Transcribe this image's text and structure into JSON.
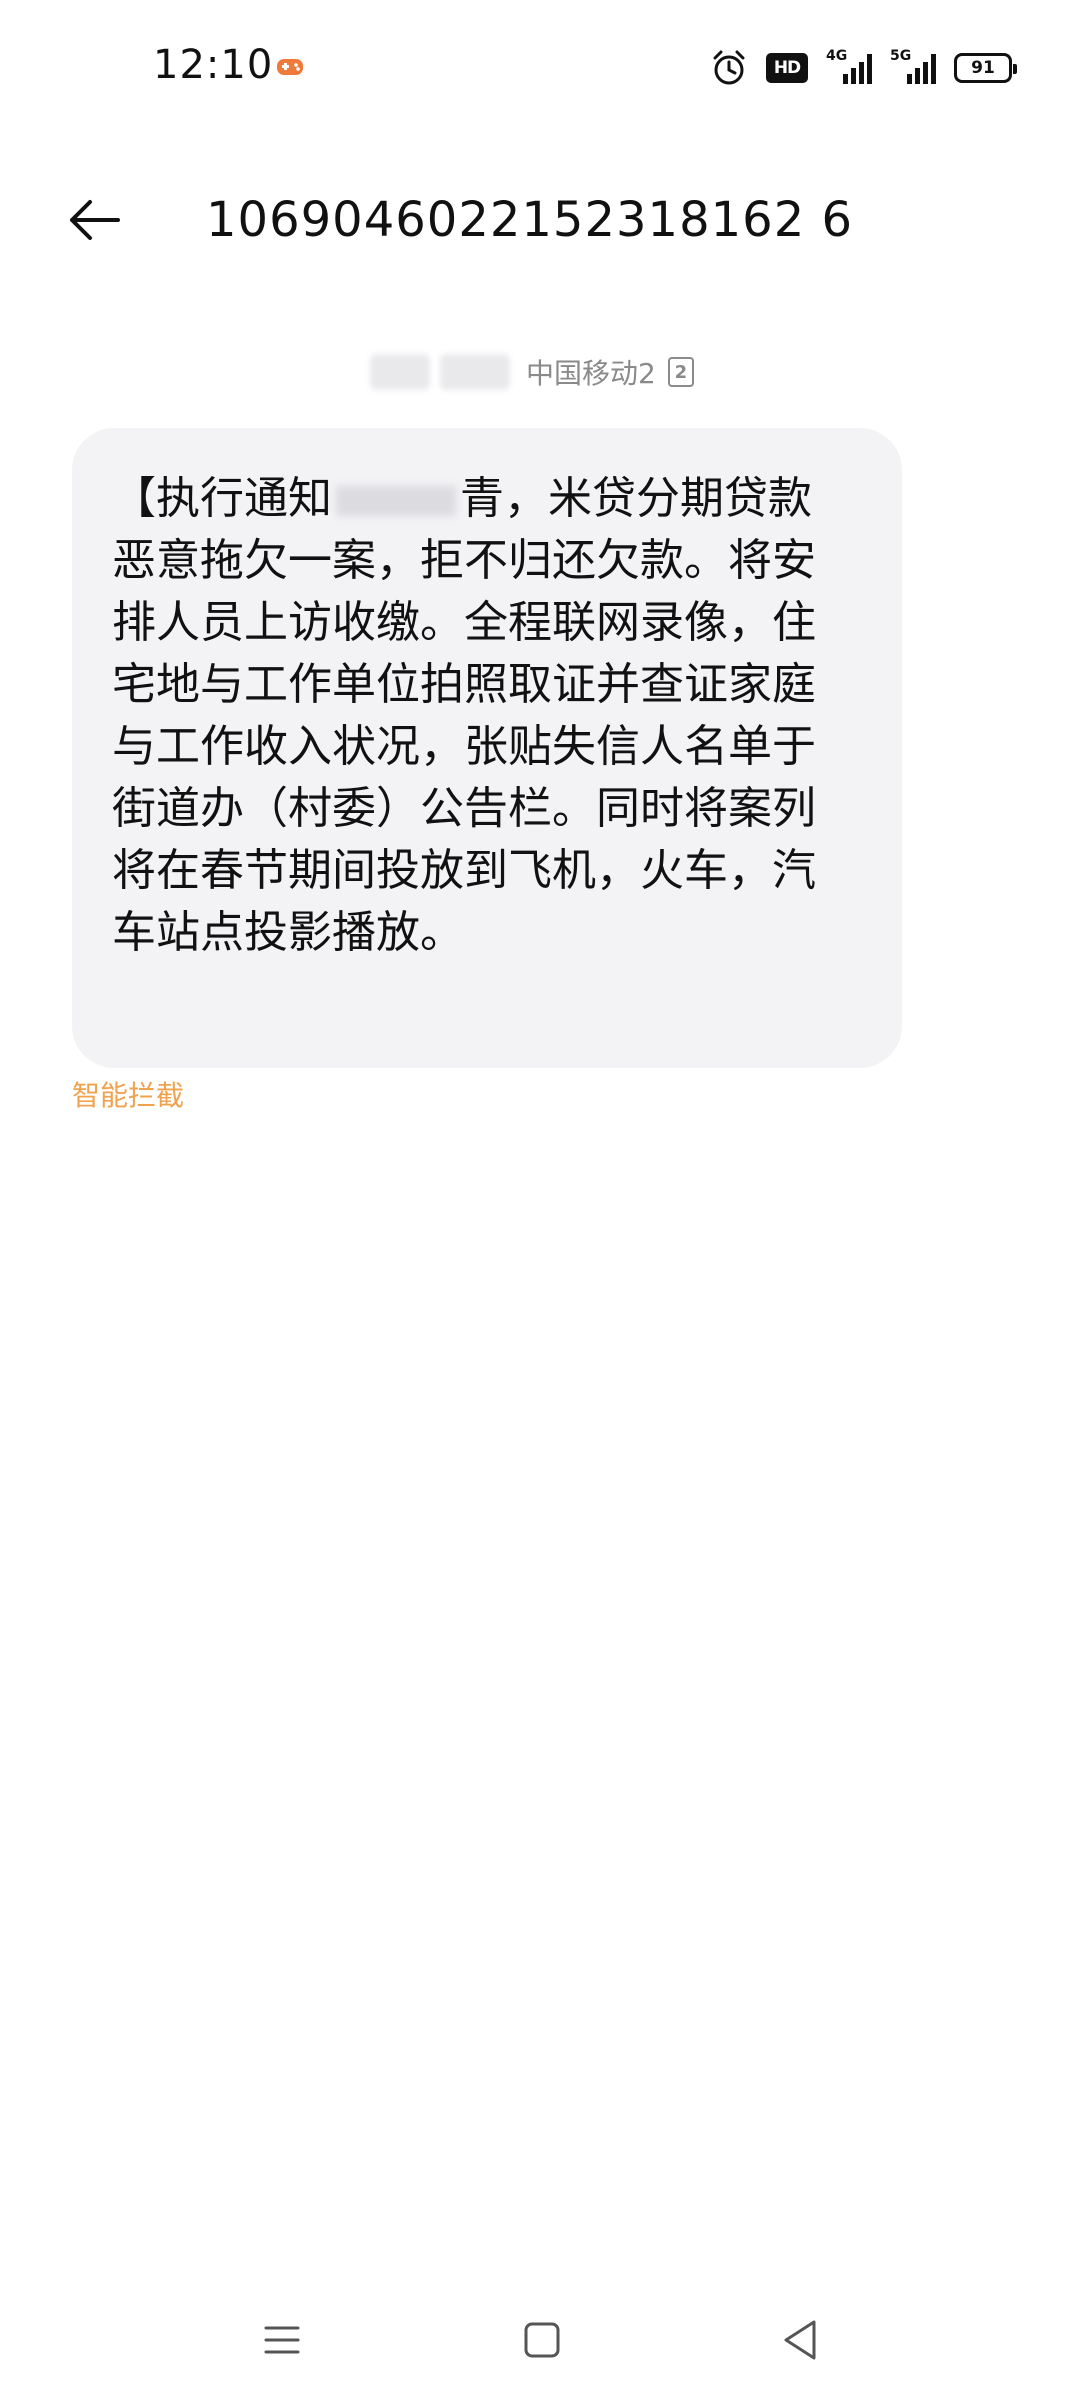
{
  "status_bar": {
    "time": "12:10",
    "hd_label": "HD",
    "signal_1_label": "4G",
    "signal_2_label": "5G",
    "battery_level": "91"
  },
  "header": {
    "title": "1069046022152318162 6"
  },
  "sender": {
    "carrier": "中国移动2",
    "sim_number": "2"
  },
  "message": {
    "prefix": "【执行通知",
    "body": "青，米贷分期贷款恶意拖欠一案，拒不归还欠款。将安排人员上访收缴。全程联网录像，住宅地与工作单位拍照取证并查证家庭与工作收入状况，张贴失信人名单于街道办（村委）公告栏。同时将案列将在春节期间投放到飞机，火车，汽车站点投影播放。"
  },
  "labels": {
    "intercept": "智能拦截"
  },
  "colors": {
    "intercept": "#f0a24e",
    "bubble_bg": "#f3f3f6"
  }
}
